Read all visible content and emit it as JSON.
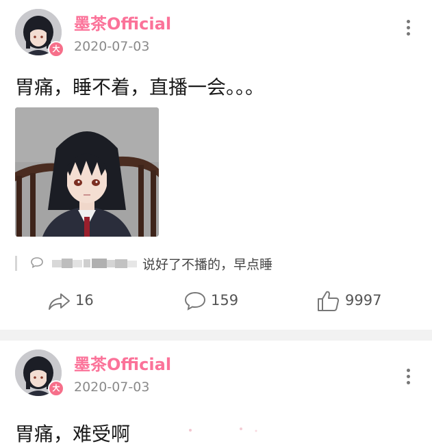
{
  "posts": [
    {
      "username": "墨茶Official",
      "date": "2020-07-03",
      "text": "胃痛，睡不着，直播一会。。。",
      "badge": "大",
      "comment": {
        "text": "说好了不播的，早点睡"
      },
      "actions": {
        "share_count": "16",
        "comment_count": "159",
        "like_count": "9997"
      }
    },
    {
      "username": "墨茶Official",
      "date": "2020-07-03",
      "text": "胃痛，难受啊",
      "badge": "大"
    }
  ],
  "colors": {
    "username": "#fb7299",
    "badge": "#f66f8a",
    "divider": "#f2f2f2",
    "secondary_text": "#8a8a8a"
  },
  "icons": [
    "more-vertical-icon",
    "comment-bubble-icon",
    "share-arrow-icon",
    "thumbs-up-icon"
  ]
}
